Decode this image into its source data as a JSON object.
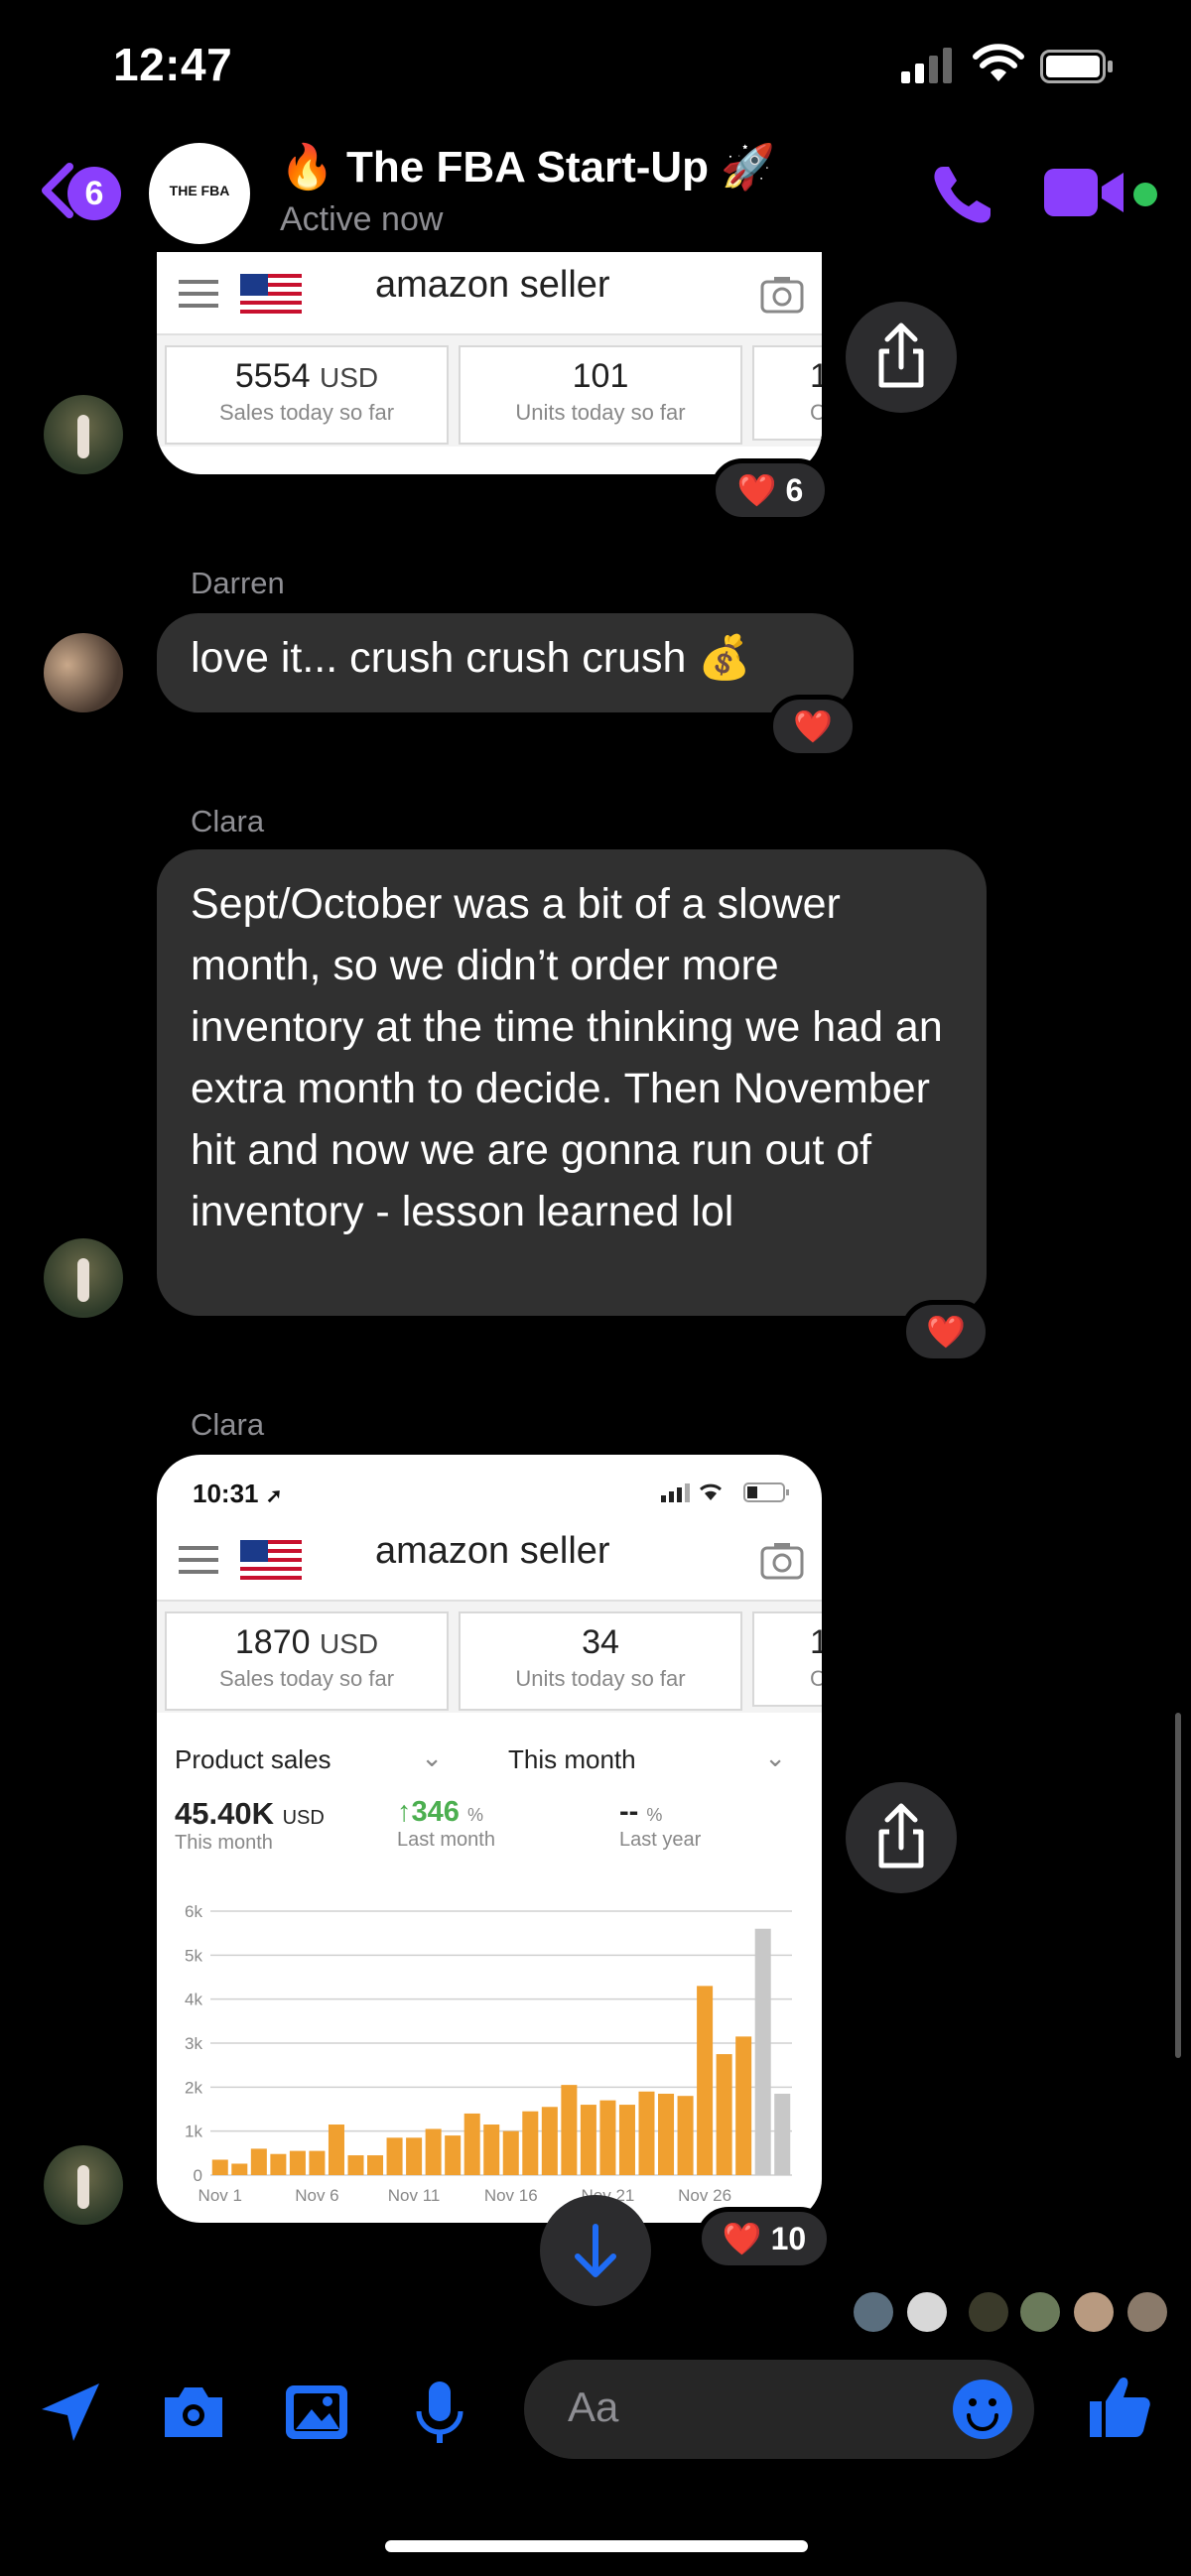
{
  "status_bar": {
    "time": "12:47"
  },
  "header": {
    "back_count": "6",
    "group_avatar_text": "THE FBA",
    "title": "🔥 The FBA Start-Up 🚀",
    "subtitle": "Active now"
  },
  "amazon_card_1": {
    "logo": "amazon seller",
    "stats": [
      {
        "value": "5554",
        "unit": "USD",
        "label": "Sales today so far"
      },
      {
        "value": "101",
        "unit": "",
        "label": "Units today so far"
      },
      {
        "value": "1",
        "unit": "",
        "label": "C"
      }
    ],
    "reaction": "❤️ 6"
  },
  "messages": [
    {
      "sender": "Darren",
      "text": "love it... crush crush crush 💰",
      "reaction": "❤️"
    },
    {
      "sender": "Clara",
      "text": "Sept/October was a bit of a slower month, so we didn’t order more inventory at the time thinking we had an extra month to decide. Then November hit and now we are gonna run out of inventory - lesson learned lol",
      "reaction": "❤️"
    }
  ],
  "amazon_card_2": {
    "sender": "Clara",
    "phone_time": "10:31",
    "logo": "amazon seller",
    "stats": [
      {
        "value": "1870",
        "unit": "USD",
        "label": "Sales today so far"
      },
      {
        "value": "34",
        "unit": "",
        "label": "Units today so far"
      },
      {
        "value": "1",
        "unit": "",
        "label": "C"
      }
    ],
    "dropdown_left": "Product sales",
    "dropdown_right": "This month",
    "kpi_total": "45.40K",
    "kpi_total_unit": "USD",
    "kpi_total_label": "This month",
    "kpi_change": "346",
    "kpi_change_unit": "%",
    "kpi_change_label": "Last month",
    "kpi_year": "--",
    "kpi_year_unit": "%",
    "kpi_year_label": "Last year",
    "reaction": "❤️ 10"
  },
  "chart_data": {
    "type": "bar",
    "title": "",
    "xlabel": "",
    "ylabel": "",
    "ylim": [
      0,
      6000
    ],
    "y_ticks": [
      "0",
      "1k",
      "2k",
      "3k",
      "4k",
      "5k",
      "6k"
    ],
    "x_tick_labels": [
      "Nov 1",
      "Nov 6",
      "Nov 11",
      "Nov 16",
      "Nov 21",
      "Nov 26"
    ],
    "categories": [
      "Nov 1",
      "Nov 2",
      "Nov 3",
      "Nov 4",
      "Nov 5",
      "Nov 6",
      "Nov 7",
      "Nov 8",
      "Nov 9",
      "Nov 10",
      "Nov 11",
      "Nov 12",
      "Nov 13",
      "Nov 14",
      "Nov 15",
      "Nov 16",
      "Nov 17",
      "Nov 18",
      "Nov 19",
      "Nov 20",
      "Nov 21",
      "Nov 22",
      "Nov 23",
      "Nov 24",
      "Nov 25",
      "Nov 26",
      "Nov 27",
      "Nov 28",
      "Nov 29",
      "Nov 30"
    ],
    "values": [
      350,
      260,
      600,
      480,
      550,
      550,
      1150,
      450,
      450,
      850,
      850,
      1050,
      900,
      1400,
      1150,
      1000,
      1450,
      1550,
      2050,
      1600,
      1700,
      1600,
      1900,
      1850,
      1800,
      4300,
      2750,
      3150,
      5600,
      1850
    ],
    "bar_colors": [
      "#f0a030",
      "#f0a030",
      "#f0a030",
      "#f0a030",
      "#f0a030",
      "#f0a030",
      "#f0a030",
      "#f0a030",
      "#f0a030",
      "#f0a030",
      "#f0a030",
      "#f0a030",
      "#f0a030",
      "#f0a030",
      "#f0a030",
      "#f0a030",
      "#f0a030",
      "#f0a030",
      "#f0a030",
      "#f0a030",
      "#f0a030",
      "#f0a030",
      "#f0a030",
      "#f0a030",
      "#f0a030",
      "#f0a030",
      "#f0a030",
      "#f0a030",
      "#c8c8c8",
      "#c8c8c8"
    ],
    "grid": true
  },
  "composer": {
    "placeholder": "Aa"
  },
  "colors": {
    "accent": "#8a3ffc",
    "blue": "#1f6cf5",
    "bubble": "#303030",
    "bar": "#f0a030",
    "green": "#4caf50"
  }
}
